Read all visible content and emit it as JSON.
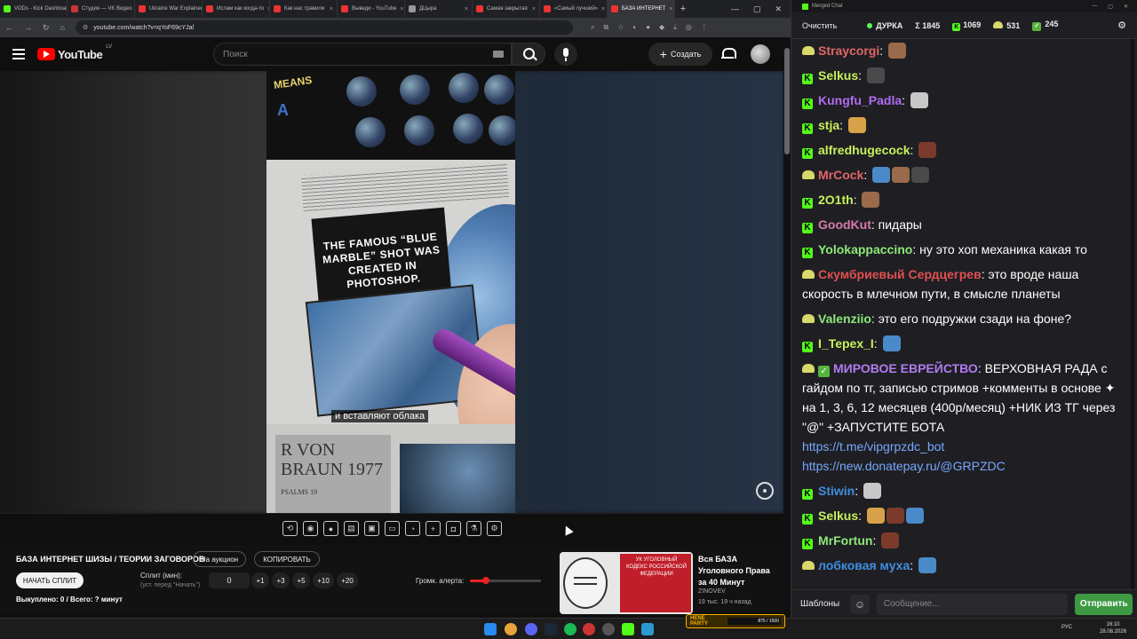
{
  "tabs": [
    {
      "label": "VODs - Kick Dashboard",
      "color": "#53fc18"
    },
    {
      "label": "Студия — VK Видео",
      "color": "#c33"
    },
    {
      "label": "Ukraine War Explained",
      "color": "#e33"
    },
    {
      "label": "Ислам как когда-то",
      "color": "#e33"
    },
    {
      "label": "Как нас травили",
      "color": "#e33"
    },
    {
      "label": "Выведи - YouTube",
      "color": "#e33"
    },
    {
      "label": "ДЦыра",
      "color": "#999"
    },
    {
      "label": "Самая закрытая",
      "color": "#e33"
    },
    {
      "label": "«Самый лучший»",
      "color": "#e33"
    },
    {
      "label": "БАЗА ИНТЕРНЕТ",
      "color": "#e33",
      "active": true
    }
  ],
  "browser": {
    "url": "youtube.com/watch?v=qYoF69cYJal",
    "new_tab": "+"
  },
  "youtube": {
    "logo": "YouTube",
    "region": "LV",
    "search_placeholder": "Поиск",
    "create_label": "Создать"
  },
  "video": {
    "subtitle": "и вставляют облака",
    "book_title": "THE FAMOUS “BLUE MARBLE” SHOT WAS CREATED IN PHOTOSHOP.",
    "book_header1": "MEANS",
    "book_header2": "A",
    "book_name": "R VON BRAUN 1977",
    "book_psalm": "PSALMS 19"
  },
  "panel": {
    "title": "БАЗА ИНТЕРНЕТ ШИЗЫ / ТЕОРИИ ЗАГОВОРОВ",
    "auction_btn": "На аукцион",
    "copy_btn": "КОПИРОВАТЬ",
    "start_split_btn": "НАЧАТЬ СПЛИТ",
    "split_label": "Сплит (мин):",
    "split_hint": "(уст. перед \"Начать\")",
    "split_value": "0",
    "increments": [
      "+1",
      "+3",
      "+5",
      "+10",
      "+20"
    ],
    "volume_label": "Громк. алерта:",
    "volume_level": 0.22,
    "status": "Выкуплено: 0 / Всего: ? минут"
  },
  "recommend": {
    "title": "Вся БАЗА Уголовного Права за 40 Минут",
    "channel": "ZINOVEV",
    "meta": "19 тыс.  19 ч назад",
    "thumb_text": "УК УГОЛОВНЫЙ КОДЕКС РОССИЙСКОЙ ФЕДЕРАЦИИ"
  },
  "twitch_overlay": {
    "label": "HENE PARTY",
    "progress": "875 / 1500"
  },
  "taskbar": {
    "lang": "РУС",
    "time": "16:10",
    "date": "28.08.2026"
  },
  "chat": {
    "window_title": "Merged Chat",
    "clear_label": "Очистить",
    "channel": "ДУРКА",
    "stats": [
      "Σ 1845",
      "1069",
      "531",
      "245"
    ],
    "messages": [
      {
        "platform": "twitch",
        "user": "Straycorgi",
        "color": "#e06666",
        "text": "",
        "emotes": 1
      },
      {
        "platform": "kick",
        "user": "Selkus",
        "color": "#c9f05a",
        "text": "",
        "emotes": 1
      },
      {
        "platform": "kick",
        "user": "Kungfu_Padla",
        "color": "#b06cf0",
        "text": "",
        "emotes": 1
      },
      {
        "platform": "kick",
        "user": "stja",
        "color": "#c9f05a",
        "text": "",
        "emotes": 1
      },
      {
        "platform": "kick",
        "user": "alfredhugecock",
        "color": "#c9f05a",
        "text": "",
        "emotes": 1
      },
      {
        "platform": "twitch",
        "user": "MrCock",
        "color": "#e06666",
        "text": "",
        "emotes": 3
      },
      {
        "platform": "kick",
        "user": "2O1th",
        "color": "#c9f05a",
        "text": "",
        "emotes": 1
      },
      {
        "platform": "kick",
        "user": "GoodKut",
        "color": "#d87aaa",
        "text": "пидары",
        "emotes": 0
      },
      {
        "platform": "kick",
        "user": "Yolokappaccino",
        "color": "#8ee87a",
        "text": "ну это хоп механика какая то",
        "emotes": 0
      },
      {
        "platform": "twitch",
        "user": "Скумбриевый Сердцегрев",
        "color": "#e05050",
        "text": "это вроде наша скорость в млечном пути, в смысле планеты",
        "emotes": 0
      },
      {
        "platform": "twitch",
        "user": "Valenziio",
        "color": "#8ee87a",
        "text": "это его подружки сзади на фоне?",
        "emotes": 0
      },
      {
        "platform": "kick",
        "user": "I_Tepex_I",
        "color": "#c9f05a",
        "text": "",
        "emotes": 1
      },
      {
        "platform": "twitch",
        "user": "МИРОВОЕ ЕВРЕЙСТВО",
        "color": "#b07cf0",
        "text": "ВЕРХОВНАЯ РАДА с гайдом по тг, записью стримов +комменты в основе  ✦  на 1, 3, 6, 12 месяцев (400р/месяц) +НИК ИЗ ТГ через \"@\" +ЗАПУСТИТЕ БОТА",
        "emotes": 0,
        "checkmark": true
      },
      {
        "platform": "none",
        "user": "",
        "color": "#fff",
        "text": "",
        "emotes": 0,
        "links": [
          "https://t.me/vipgrpzdc_bot",
          "https://new.donatepay.ru/@GRPZDC"
        ]
      },
      {
        "platform": "kick",
        "user": "Stiwin",
        "color": "#3e8ee0",
        "text": "",
        "emotes": 1
      },
      {
        "platform": "kick",
        "user": "Selkus",
        "color": "#c9f05a",
        "text": "",
        "emotes": 3
      },
      {
        "platform": "kick",
        "user": "MrFortun",
        "color": "#8ee87a",
        "text": "",
        "emotes": 1
      },
      {
        "platform": "twitch",
        "user": "лобковая муха",
        "color": "#3e8ee0",
        "text": "",
        "emotes": 1
      }
    ],
    "templates_label": "Шаблоны",
    "input_placeholder": "Сообщение...",
    "send_label": "Отправить"
  }
}
